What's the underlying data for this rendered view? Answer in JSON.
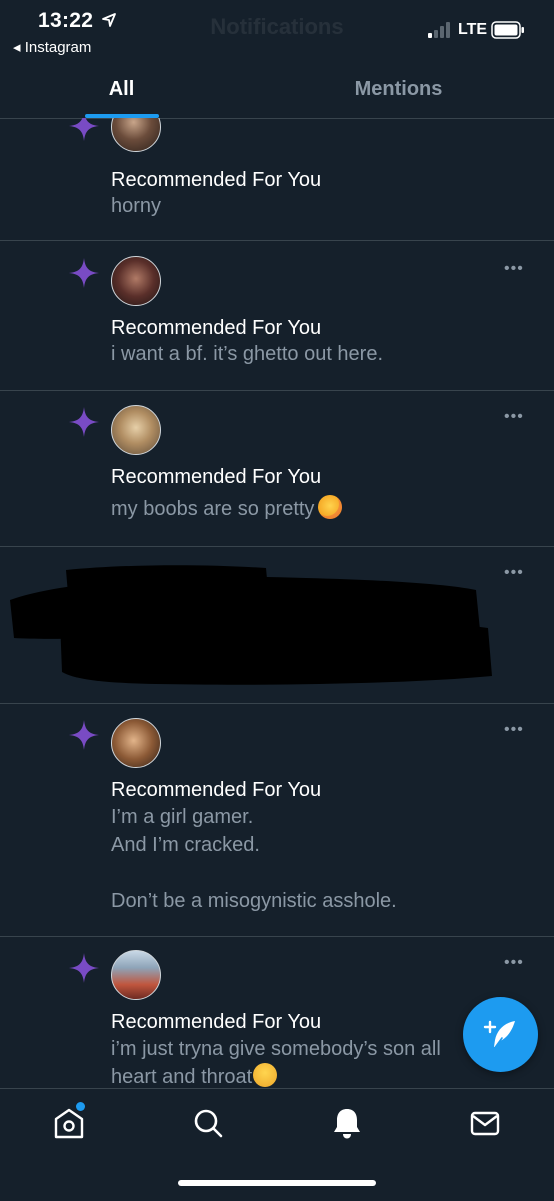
{
  "status_bar": {
    "time": "13:22",
    "back_app": "◂ Instagram",
    "network": "LTE",
    "faded_title": "Notifications"
  },
  "tabs": [
    {
      "label": "All",
      "active": true
    },
    {
      "label": "Mentions",
      "active": false
    }
  ],
  "notifications": [
    {
      "title": "Recommended For You",
      "lines": [
        "horny"
      ]
    },
    {
      "title": "Recommended For You",
      "lines": [
        "i want a bf. it’s ghetto out here."
      ]
    },
    {
      "title": "Recommended For You",
      "lines": [
        "my boobs are so pretty"
      ],
      "emoji": "smiling-face-with-hearts-emoji"
    },
    {
      "redacted": true
    },
    {
      "title": "Recommended For You",
      "lines": [
        "I’m a girl gamer.",
        "And I’m cracked.",
        "",
        "Don’t be a misogynistic asshole."
      ]
    },
    {
      "title": "Recommended For You",
      "lines": [
        "i’m just tryna give somebody’s son all",
        "heart and throat"
      ],
      "emoji": "face-with-hand-over-mouth-emoji"
    }
  ],
  "more_label": "•••",
  "bottom_nav": [
    {
      "icon": "home-icon",
      "has_dot": true
    },
    {
      "icon": "search-icon"
    },
    {
      "icon": "bell-icon",
      "active": true
    },
    {
      "icon": "mail-icon"
    }
  ],
  "colors": {
    "background": "#15202b",
    "accent": "#1d9bf0",
    "sparkle": "#794bc4",
    "secondary_text": "#8b98a5",
    "divider": "#38444d"
  }
}
